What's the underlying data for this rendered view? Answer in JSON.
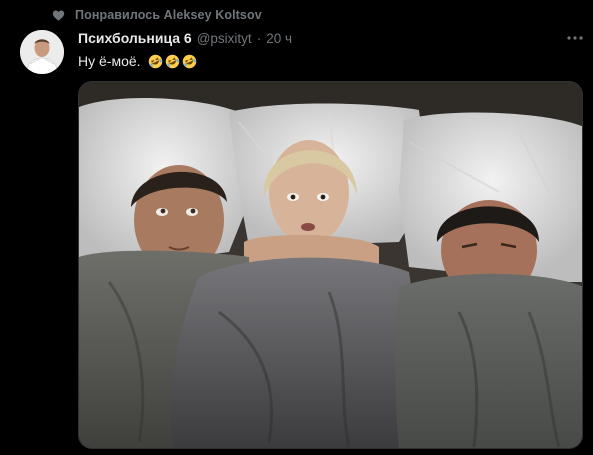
{
  "social_context": {
    "icon": "heart-icon",
    "text": "Понравилось Aleksey Koltsov"
  },
  "author": {
    "display_name": "Психбольница 6",
    "handle": "@psixityt",
    "separator": "·",
    "time": "20 ч",
    "avatar_icon": "avatar"
  },
  "tweet": {
    "text": "Ну ё-моё.",
    "emojis": [
      "rolling-on-floor-laughing-emoji",
      "rolling-on-floor-laughing-emoji",
      "rolling-on-floor-laughing-emoji"
    ]
  },
  "media": {
    "type": "photo"
  },
  "colors": {
    "background": "#000000",
    "primary_text": "#e7e9ea",
    "secondary_text": "#71767b",
    "border": "#2f3336"
  }
}
